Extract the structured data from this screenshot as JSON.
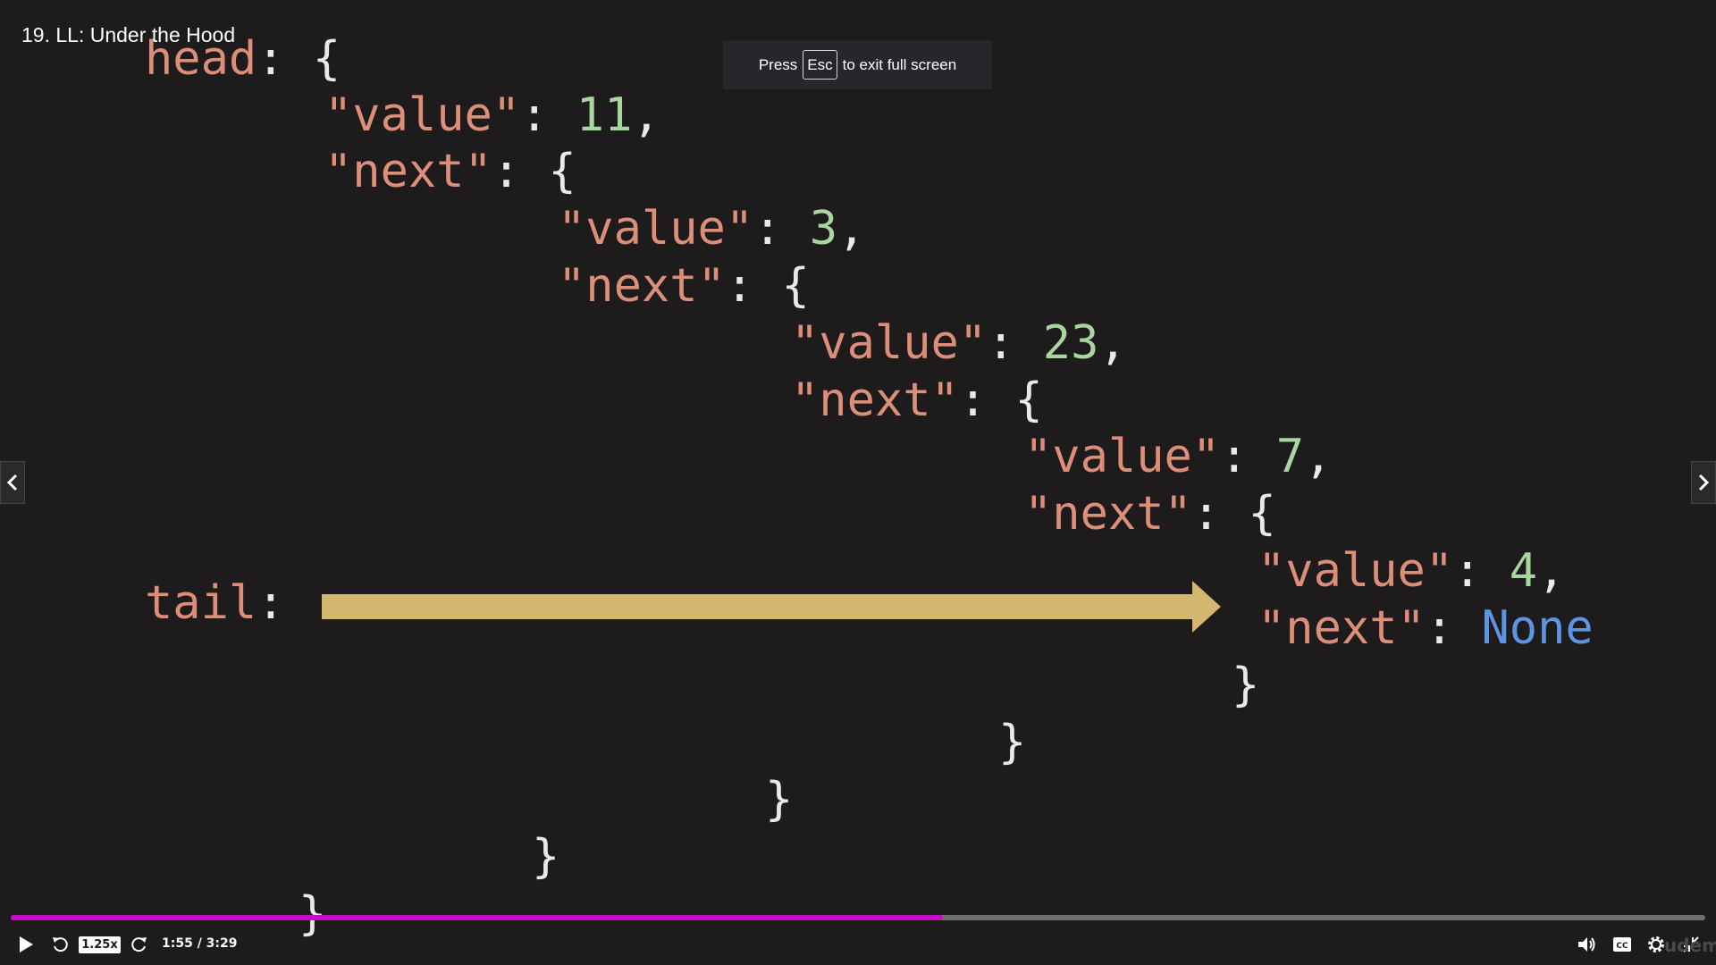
{
  "lecture": {
    "title": "19. LL: Under the Hood"
  },
  "fullscreen_toast": {
    "prefix": "Press",
    "key": "Esc",
    "suffix": "to exit full screen"
  },
  "code": {
    "head_label": "head",
    "tail_label": "tail",
    "key_value": "\"value\"",
    "key_next": "\"next\"",
    "values": [
      "11",
      "3",
      "23",
      "7",
      "4"
    ],
    "none_literal": "None"
  },
  "colors": {
    "background": "#1d1b1c",
    "key": "#dd8e78",
    "number": "#a9d6a0",
    "keyword": "#5f93e4",
    "arrow": "#d3b76e",
    "progress": "#c70cc9"
  },
  "player": {
    "speed": "1.25x",
    "time": "1:55 / 3:29",
    "progress_fraction": 0.55,
    "watermark": "udemy"
  },
  "icons": {
    "play": "play-icon",
    "rewind": "rewind-icon",
    "forward": "forward-icon",
    "volume": "volume-icon",
    "captions": "captions-icon",
    "settings": "gear-icon",
    "exit_fullscreen": "exit-fullscreen-icon",
    "prev": "chevron-left-icon",
    "next": "chevron-right-icon"
  }
}
